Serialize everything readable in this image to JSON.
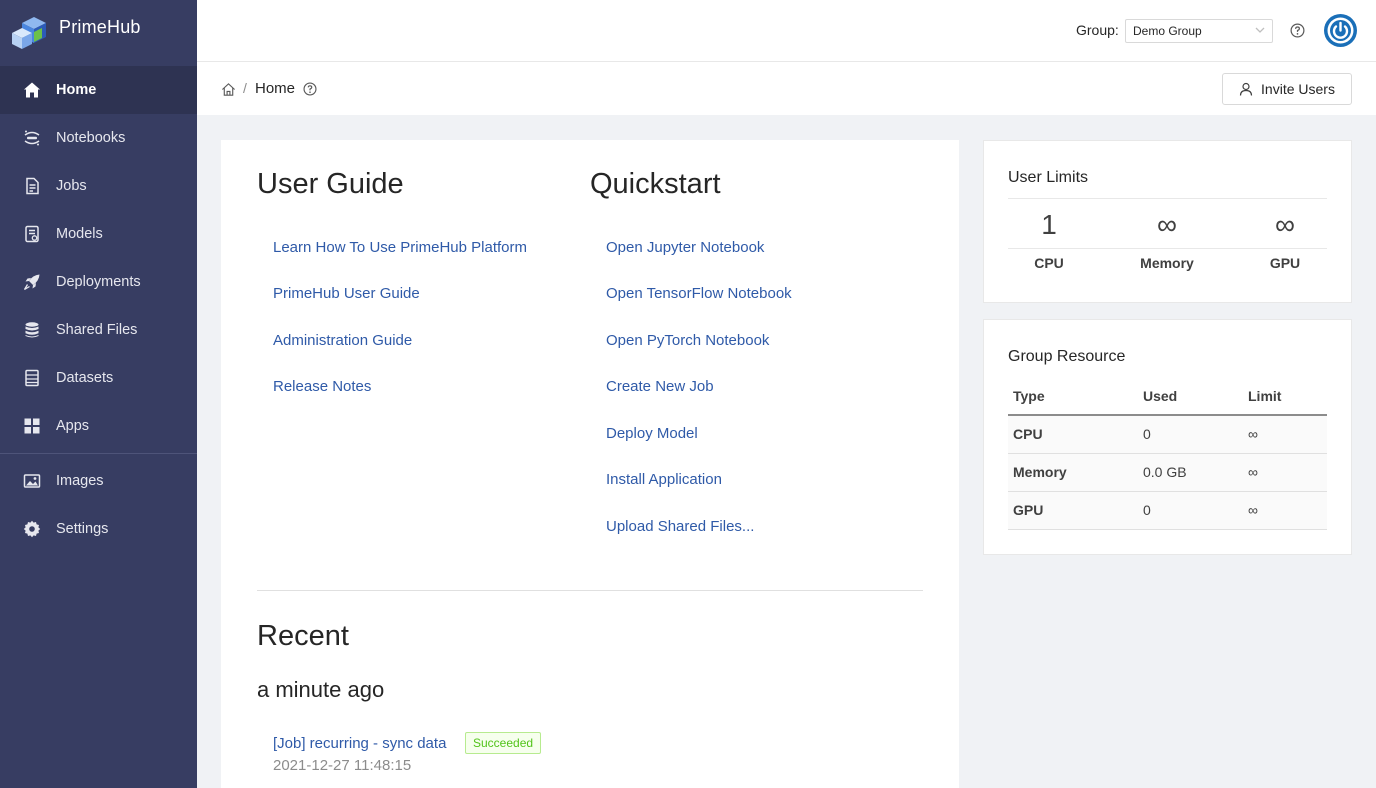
{
  "brand": {
    "name": "PrimeHub"
  },
  "sidebar": {
    "items": [
      {
        "label": "Home",
        "icon": "home-icon",
        "active": true
      },
      {
        "label": "Notebooks",
        "icon": "jupyter-icon"
      },
      {
        "label": "Jobs",
        "icon": "jobs-icon"
      },
      {
        "label": "Models",
        "icon": "models-icon"
      },
      {
        "label": "Deployments",
        "icon": "rocket-icon"
      },
      {
        "label": "Shared Files",
        "icon": "database-icon"
      },
      {
        "label": "Datasets",
        "icon": "datasets-icon"
      },
      {
        "label": "Apps",
        "icon": "apps-icon"
      },
      {
        "label": "Images",
        "icon": "images-icon"
      },
      {
        "label": "Settings",
        "icon": "gear-icon"
      }
    ]
  },
  "header": {
    "group_label": "Group:",
    "group_value": "Demo Group"
  },
  "breadcrumb": {
    "separator": "/",
    "title": "Home"
  },
  "toolbar": {
    "invite_label": "Invite Users"
  },
  "guide": {
    "title": "User Guide",
    "links": [
      "Learn How To Use PrimeHub Platform",
      "PrimeHub User Guide",
      "Administration Guide",
      "Release Notes"
    ]
  },
  "quickstart": {
    "title": "Quickstart",
    "links": [
      "Open Jupyter Notebook",
      "Open TensorFlow Notebook",
      "Open PyTorch Notebook",
      "Create New Job",
      "Deploy Model",
      "Install Application",
      "Upload Shared Files..."
    ]
  },
  "recent": {
    "title": "Recent",
    "time_group": "a minute ago",
    "item": {
      "label": "[Job] recurring - sync data",
      "status": "Succeeded",
      "timestamp": "2021-12-27 11:48:15"
    }
  },
  "user_limits": {
    "title": "User Limits",
    "items": [
      {
        "value": "1",
        "label": "CPU"
      },
      {
        "value": "∞",
        "label": "Memory"
      },
      {
        "value": "∞",
        "label": "GPU"
      }
    ]
  },
  "group_resource": {
    "title": "Group Resource",
    "headers": [
      "Type",
      "Used",
      "Limit"
    ],
    "rows": [
      [
        "CPU",
        "0",
        "∞"
      ],
      [
        "Memory",
        "0.0 GB",
        "∞"
      ],
      [
        "GPU",
        "0",
        "∞"
      ]
    ]
  },
  "colors": {
    "sidebar_bg": "#373d62",
    "active_bg": "#2e3352",
    "link": "#2f5aa8",
    "success": "#52c41a",
    "avatar": "#1a6fb8"
  }
}
